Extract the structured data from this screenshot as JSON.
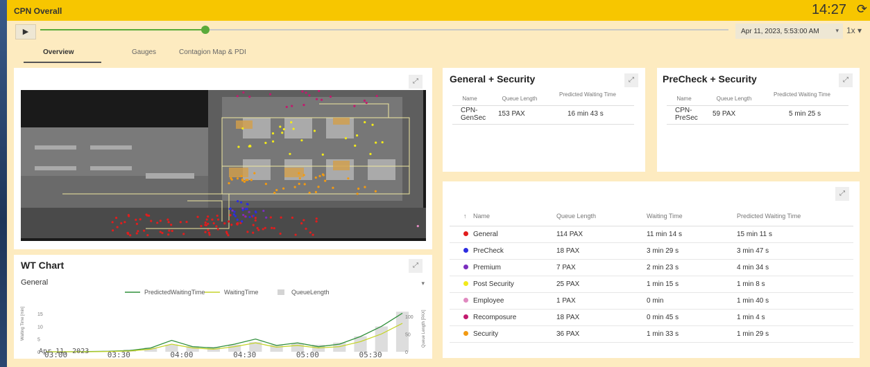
{
  "app": {
    "title": "CPN Overall",
    "clock": "14:27",
    "sync_icon": "sync-icon"
  },
  "player": {
    "play_icon": "play-icon",
    "play_glyph": "▶",
    "progress": 0.24,
    "datetime": "Apr 11, 2023, 5:53:00 AM",
    "speed": "1x"
  },
  "tabs": [
    {
      "label": "Overview",
      "active": true
    },
    {
      "label": "Gauges",
      "active": false
    },
    {
      "label": "Contagion Map & PDI",
      "active": false
    }
  ],
  "general_security": {
    "title": "General + Security",
    "headers": [
      "Name",
      "Queue Length",
      "Predicted Waiting Time"
    ],
    "row": {
      "name": "CPN-GenSec",
      "queue": "153 PAX",
      "predicted": "16 min 43 s"
    }
  },
  "precheck_security": {
    "title": "PreCheck + Security",
    "headers": [
      "Name",
      "Queue Length",
      "Predicted Waiting Time"
    ],
    "row": {
      "name": "CPN-PreSec",
      "queue": "59 PAX",
      "predicted": "5 min 25 s"
    }
  },
  "queue_table": {
    "sort_icon": "↑",
    "headers": [
      "Name",
      "Queue Length",
      "Waiting Time",
      "Predicted Waiting Time"
    ],
    "rows": [
      {
        "color": "#e11d1d",
        "name": "General",
        "queue": "114 PAX",
        "waiting": "11 min 14 s",
        "predicted": "15 min 11 s"
      },
      {
        "color": "#2d2de0",
        "name": "PreCheck",
        "queue": "18 PAX",
        "waiting": "3 min 29 s",
        "predicted": "3 min 47 s"
      },
      {
        "color": "#7b2fbe",
        "name": "Premium",
        "queue": "7 PAX",
        "waiting": "2 min 23 s",
        "predicted": "4 min 34 s"
      },
      {
        "color": "#f2ea1a",
        "name": "Post Security",
        "queue": "25 PAX",
        "waiting": "1 min 15 s",
        "predicted": "1 min 8 s"
      },
      {
        "color": "#e08ac0",
        "name": "Employee",
        "queue": "1 PAX",
        "waiting": "0 min",
        "predicted": "1 min 40 s"
      },
      {
        "color": "#c21a6e",
        "name": "Recomposure",
        "queue": "18 PAX",
        "waiting": "0 min 45 s",
        "predicted": "1 min 4 s"
      },
      {
        "color": "#f29a12",
        "name": "Security",
        "queue": "36 PAX",
        "waiting": "1 min 33 s",
        "predicted": "1 min 29 s"
      }
    ]
  },
  "wt_chart": {
    "title": "WT Chart",
    "selected": "General",
    "date_label": "Apr 11, 2023"
  },
  "chart_data": {
    "type": "line",
    "title": "WT Chart",
    "xlabel": "",
    "ylabel": "Waiting Time [min]",
    "y2label": "Queue Length [PAX]",
    "x_ticks": [
      "03:00",
      "03:30",
      "04:00",
      "04:30",
      "05:00",
      "05:30"
    ],
    "x": [
      "03:00",
      "03:10",
      "03:20",
      "03:30",
      "03:40",
      "03:50",
      "04:00",
      "04:10",
      "04:20",
      "04:30",
      "04:40",
      "04:50",
      "05:00",
      "05:10",
      "05:20",
      "05:30",
      "05:40",
      "05:53"
    ],
    "ylim": [
      0,
      18
    ],
    "y_ticks": [
      0,
      5,
      10,
      15
    ],
    "y2lim": [
      0,
      130
    ],
    "y2_ticks": [
      0,
      50,
      100
    ],
    "legend_position": "top",
    "series": [
      {
        "name": "PredictedWaitingTime",
        "color": "#2f8f3a",
        "axis": "left",
        "values": [
          0,
          0,
          0.1,
          0.2,
          0.5,
          1.5,
          4.5,
          2,
          1.5,
          3,
          5,
          2.5,
          3.5,
          2,
          3,
          6,
          10,
          15.2
        ]
      },
      {
        "name": "WaitingTime",
        "color": "#c5d42a",
        "axis": "left",
        "values": [
          0,
          0,
          0,
          0.1,
          0.3,
          1,
          3,
          1.5,
          1,
          2,
          3.5,
          1.8,
          2.5,
          1.5,
          2,
          4,
          7,
          11.2
        ]
      },
      {
        "name": "QueueLength",
        "color": "#d4d4d4",
        "axis": "right",
        "type": "bar",
        "values": [
          0,
          0,
          2,
          3,
          6,
          12,
          20,
          16,
          14,
          20,
          28,
          20,
          24,
          20,
          26,
          44,
          72,
          114
        ]
      }
    ]
  }
}
